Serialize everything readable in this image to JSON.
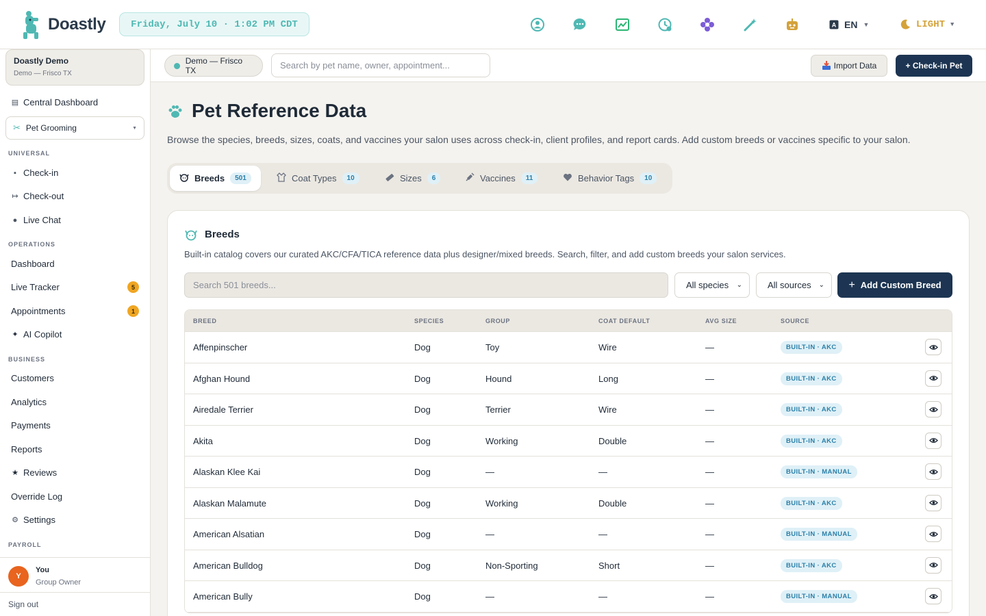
{
  "app": {
    "name": "Doastly"
  },
  "header": {
    "datetime": "Friday, July 10 · 1:02 PM CDT",
    "icons": [
      "profile-icon",
      "chat-icon",
      "chart-icon",
      "history-icon",
      "flower-icon",
      "magic-wand-icon",
      "robot-icon"
    ],
    "language": "EN",
    "theme": "LIGHT",
    "colors": {
      "teal": "#4fb8b3",
      "green": "#2bb673",
      "purple": "#7c5cd6",
      "gold": "#d4a23a",
      "navy": "#1d3552"
    }
  },
  "sidebar": {
    "org_name": "Doastly Demo",
    "org_location": "Demo — Frisco TX",
    "central_dashboard": "Central Dashboard",
    "module": "Pet Grooming",
    "sections": {
      "universal": "UNIVERSAL",
      "operations": "OPERATIONS",
      "business": "BUSINESS",
      "payroll": "PAYROLL"
    },
    "universal_items": [
      "Check-in",
      "Check-out",
      "Live Chat"
    ],
    "operations_items": [
      "Dashboard",
      "Live Tracker",
      "Appointments",
      "AI Copilot"
    ],
    "live_tracker_badge": "5",
    "appointments_badge": "1",
    "business_items": [
      "Customers",
      "Analytics",
      "Payments",
      "Reports",
      "Reviews",
      "Override Log",
      "Settings"
    ],
    "user": {
      "initial": "Y",
      "name": "You",
      "role": "Group Owner"
    },
    "sign_out": "Sign out"
  },
  "subheader": {
    "location": "Demo — Frisco TX",
    "search_placeholder": "Search by pet name, owner, appointment...",
    "import_label": "Import Data",
    "checkin_label": "+ Check-in Pet"
  },
  "page": {
    "title": "Pet Reference Data",
    "description": "Browse the species, breeds, sizes, coats, and vaccines your salon uses across check-in, client profiles, and report cards. Add custom breeds or vaccines specific to your salon.",
    "tabs": [
      {
        "label": "Breeds",
        "count": "501"
      },
      {
        "label": "Coat Types",
        "count": "10"
      },
      {
        "label": "Sizes",
        "count": "6"
      },
      {
        "label": "Vaccines",
        "count": "11"
      },
      {
        "label": "Behavior Tags",
        "count": "10"
      }
    ],
    "active_tab": "Breeds"
  },
  "breeds_card": {
    "title": "Breeds",
    "description": "Built-in catalog covers our curated AKC/CFA/TICA reference data plus designer/mixed breeds. Search, filter, and add custom breeds your salon services.",
    "search_placeholder": "Search 501 breeds...",
    "species_filter": "All species",
    "source_filter": "All sources",
    "add_label": "Add Custom Breed",
    "columns": [
      "BREED",
      "SPECIES",
      "GROUP",
      "COAT DEFAULT",
      "AVG SIZE",
      "SOURCE"
    ],
    "rows": [
      {
        "breed": "Affenpinscher",
        "species": "Dog",
        "group": "Toy",
        "coat": "Wire",
        "size": "—",
        "source": "BUILT-IN · AKC"
      },
      {
        "breed": "Afghan Hound",
        "species": "Dog",
        "group": "Hound",
        "coat": "Long",
        "size": "—",
        "source": "BUILT-IN · AKC"
      },
      {
        "breed": "Airedale Terrier",
        "species": "Dog",
        "group": "Terrier",
        "coat": "Wire",
        "size": "—",
        "source": "BUILT-IN · AKC"
      },
      {
        "breed": "Akita",
        "species": "Dog",
        "group": "Working",
        "coat": "Double",
        "size": "—",
        "source": "BUILT-IN · AKC"
      },
      {
        "breed": "Alaskan Klee Kai",
        "species": "Dog",
        "group": "—",
        "coat": "—",
        "size": "—",
        "source": "BUILT-IN · MANUAL"
      },
      {
        "breed": "Alaskan Malamute",
        "species": "Dog",
        "group": "Working",
        "coat": "Double",
        "size": "—",
        "source": "BUILT-IN · AKC"
      },
      {
        "breed": "American Alsatian",
        "species": "Dog",
        "group": "—",
        "coat": "—",
        "size": "—",
        "source": "BUILT-IN · MANUAL"
      },
      {
        "breed": "American Bulldog",
        "species": "Dog",
        "group": "Non-Sporting",
        "coat": "Short",
        "size": "—",
        "source": "BUILT-IN · AKC"
      },
      {
        "breed": "American Bully",
        "species": "Dog",
        "group": "—",
        "coat": "—",
        "size": "—",
        "source": "BUILT-IN · MANUAL"
      }
    ]
  }
}
